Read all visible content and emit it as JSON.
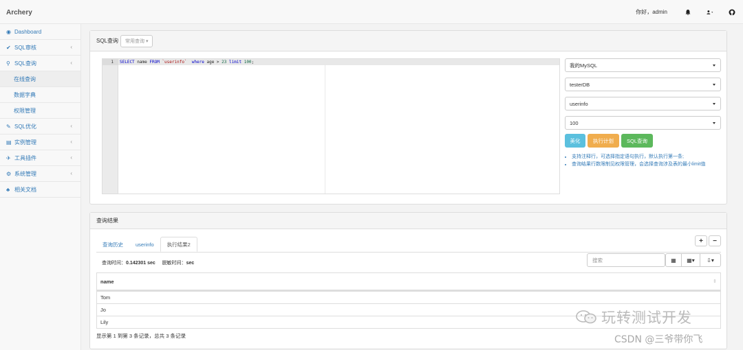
{
  "app": {
    "title": "Archery"
  },
  "topbar": {
    "greeting": "你好，admin",
    "icons": [
      "bell-icon",
      "user-icon",
      "github-icon"
    ]
  },
  "sidebar": {
    "items": [
      {
        "icon": "dashboard-icon",
        "label": "Dashboard"
      },
      {
        "icon": "check-icon",
        "label": "SQL审核"
      },
      {
        "icon": "search-icon",
        "label": "SQL查询"
      },
      {
        "label": "在线查询"
      },
      {
        "label": "数据字典"
      },
      {
        "label": "权限管理"
      },
      {
        "icon": "wrench-icon",
        "label": "SQL优化"
      },
      {
        "icon": "database-icon",
        "label": "实例管理"
      },
      {
        "icon": "plugin-icon",
        "label": "工具插件"
      },
      {
        "icon": "settings-icon",
        "label": "系统管理"
      },
      {
        "icon": "sitemap-icon",
        "label": "相关文档"
      }
    ]
  },
  "query_panel": {
    "title": "SQL查询",
    "template_button": "常用查询",
    "editor": {
      "line_number": "1",
      "sql": {
        "select": "SELECT",
        "col": " name ",
        "from": "FROM",
        "table": " `userinfo` ",
        "where": " where",
        "cond": " age > ",
        "n1": "23",
        "limit": " limit ",
        "n2": "100",
        "tail": ";"
      }
    },
    "selects": {
      "instance": "我的MySQL",
      "database": "testerDB",
      "table": "userinfo",
      "limit": "100"
    },
    "buttons": {
      "beautify": "美化",
      "explain": "执行计划",
      "query": "SQL查询"
    },
    "tips": [
      "支持注释行，可选择指定语句执行，默认执行第一条;",
      "查询结果行数限制见权限管理，会选择查询涉及表的最小limit值"
    ],
    "colors": {
      "beautify": "#5bc0de",
      "explain": "#f0ad4e",
      "query": "#5cb85c"
    }
  },
  "result_panel": {
    "title": "查询结果",
    "tabs": [
      "查询历史",
      "userinfo",
      "执行结果2"
    ],
    "active_tab": "执行结果2",
    "add_label": "+",
    "remove_label": "−",
    "query_time_label": "查询时间：",
    "query_time": "0.142301 sec",
    "mask_time_label": "脱敏时间：",
    "mask_time": "sec",
    "search_placeholder": "搜索",
    "column": "name",
    "rows": [
      "Tom",
      "Jo",
      "Lily"
    ],
    "summary": "显示第 1 到第 3 条记录，总共 3 条记录"
  },
  "watermark": {
    "line1": "玩转测试开发",
    "line2": "CSDN @三爷带你飞"
  }
}
